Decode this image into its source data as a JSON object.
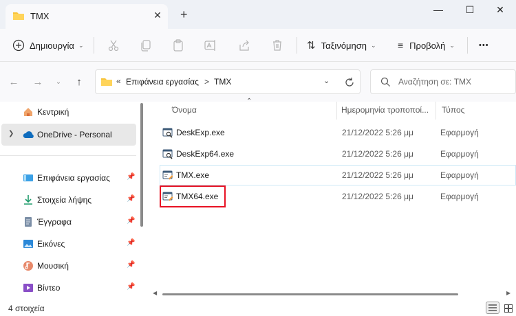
{
  "window": {
    "tab_title": "TMX",
    "new_tab_symbol": "+",
    "tab_close_symbol": "✕",
    "minimize_symbol": "—",
    "maximize_symbol": "☐",
    "close_symbol": "✕"
  },
  "toolbar": {
    "new_label": "Δημιουργία",
    "sort_label": "Ταξινόμηση",
    "view_label": "Προβολή",
    "more_symbol": "•••",
    "icons": [
      "cut-icon",
      "copy-icon",
      "paste-icon",
      "rename-icon",
      "share-icon",
      "delete-icon"
    ]
  },
  "address": {
    "prefix": "«",
    "crumbs": [
      "Επιφάνεια εργασίας",
      "TMX"
    ],
    "separator": ">"
  },
  "search": {
    "placeholder": "Αναζήτηση σε: TMX"
  },
  "sidebar": {
    "items": [
      {
        "label": "Κεντρική",
        "icon": "home-icon"
      },
      {
        "label": "OneDrive - Personal",
        "icon": "onedrive-icon"
      },
      {
        "label": "Επιφάνεια εργασίας",
        "icon": "desktop-icon"
      },
      {
        "label": "Στοιχεία λήψης",
        "icon": "downloads-icon"
      },
      {
        "label": "Έγγραφα",
        "icon": "documents-icon"
      },
      {
        "label": "Εικόνες",
        "icon": "pictures-icon"
      },
      {
        "label": "Μουσική",
        "icon": "music-icon"
      },
      {
        "label": "Βίντεο",
        "icon": "videos-icon"
      }
    ]
  },
  "filelist": {
    "columns": [
      "Όνομα",
      "Ημερομηνία τροποποί...",
      "Τύπος"
    ],
    "rows": [
      {
        "name": "DeskExp.exe",
        "date": "21/12/2022 5:26 μμ",
        "type": "Εφαρμογή",
        "icon": "app-search-icon"
      },
      {
        "name": "DeskExp64.exe",
        "date": "21/12/2022 5:26 μμ",
        "type": "Εφαρμογή",
        "icon": "app-search-icon"
      },
      {
        "name": "TMX.exe",
        "date": "21/12/2022 5:26 μμ",
        "type": "Εφαρμογή",
        "icon": "app-edit-icon"
      },
      {
        "name": "TMX64.exe",
        "date": "21/12/2022 5:26 μμ",
        "type": "Εφαρμογή",
        "icon": "app-edit-icon"
      }
    ],
    "highlight_color": "#e81123",
    "selected_border_color": "#cde8f6"
  },
  "status": {
    "item_count": "4 στοιχεία"
  },
  "colors": {
    "accent": "#0067c0",
    "folder": "#f8c33a"
  }
}
